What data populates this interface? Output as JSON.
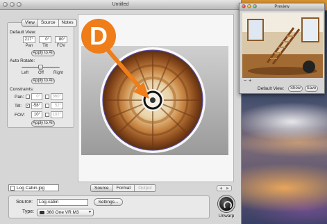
{
  "main_window": {
    "title": "Untitled"
  },
  "left_panel": {
    "tabs": [
      {
        "label": "View"
      },
      {
        "label": "Source"
      },
      {
        "label": "Notes"
      }
    ],
    "default_view": {
      "label": "Default View:",
      "pan_value": "217°",
      "tilt_value": "0°",
      "fov_value": "80°",
      "pan_label": "Pan",
      "tilt_label": "Tilt",
      "fov_label": "FOV",
      "apply_label": "Apply to All"
    },
    "auto_rotate": {
      "label": "Auto Rotate:",
      "left_label": "Left",
      "off_label": "Off",
      "right_label": "Right",
      "value": 0.5,
      "apply_label": "Apply to All"
    },
    "constraints": {
      "label": "Constraints:",
      "pan_label": "Pan:",
      "pan_min": "0°",
      "pan_max": "360°",
      "tilt_label": "Tilt:",
      "tilt_min": "-58°",
      "tilt_max": "52°",
      "tilt_check": "✓",
      "fov_label": "FOV:",
      "fov_min": "10°",
      "fov_max": "102°",
      "apply_label": "Apply to All"
    }
  },
  "bottom": {
    "file_name": "Log Cabin.jpg",
    "tabs": [
      {
        "label": "Source"
      },
      {
        "label": "Format"
      },
      {
        "label": "Output"
      }
    ],
    "nav_left": "◀",
    "nav_right": "▶"
  },
  "source_box": {
    "source_label": "Source:",
    "source_value": "Log-cabin",
    "settings_label": "Settings...",
    "type_label": "Type:",
    "type_value": "360 One VR M3",
    "type_caret": "▾"
  },
  "unwarp": {
    "label": "Unwarp"
  },
  "preview_window": {
    "title": "Preview",
    "zoom_out": "−",
    "zoom_in": "+",
    "default_view_label": "Default View:",
    "show_label": "Show",
    "save_label": "Save"
  },
  "callout": {
    "letter": "D",
    "color": "#ef7d1a"
  }
}
